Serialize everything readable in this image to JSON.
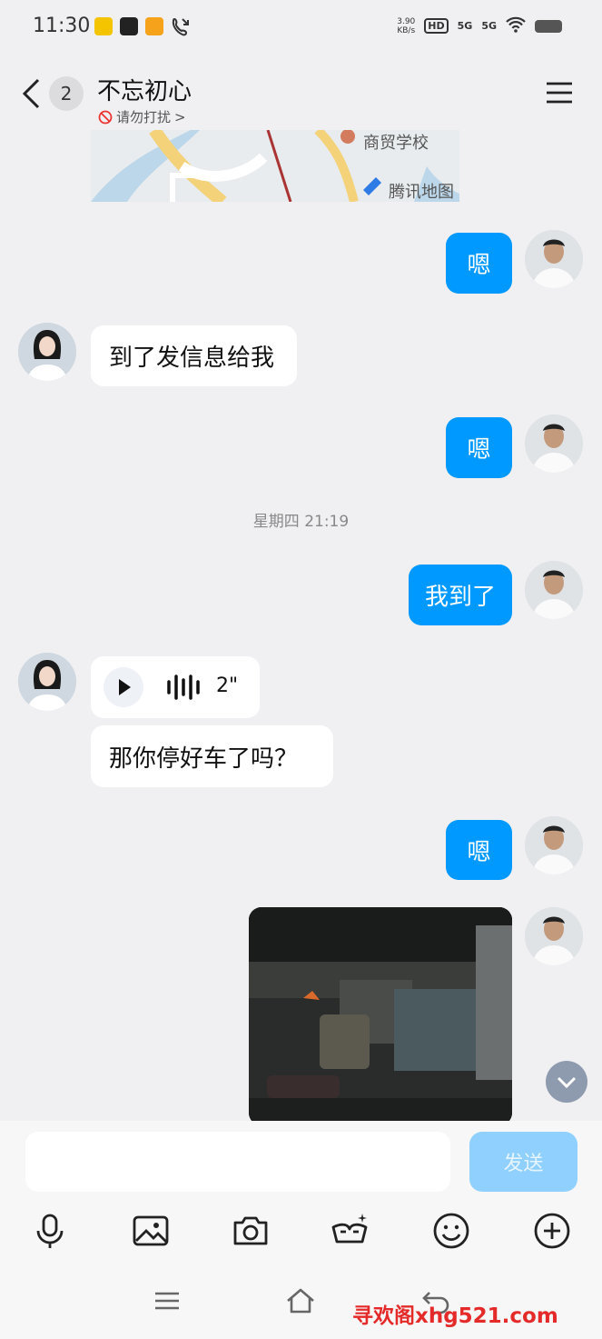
{
  "status_bar": {
    "time": "11:30",
    "net_speed_value": "3.90",
    "net_speed_unit": "KB/s",
    "hd_label": "HD",
    "signal_1": "5G",
    "signal_2": "5G"
  },
  "header": {
    "unread_count": "2",
    "title": "不忘初心",
    "dnd_label": "请勿打扰",
    "dnd_chevron": ">"
  },
  "map": {
    "place_label": "商贸学校",
    "provider_label": "腾讯地图"
  },
  "messages": {
    "me_1": "嗯",
    "other_1": "到了发信息给我",
    "me_2": "嗯",
    "timestamp": "星期四 21:19",
    "me_3": "我到了",
    "voice_duration": "2\"",
    "other_2": "那你停好车了吗？",
    "me_4": "嗯"
  },
  "input": {
    "placeholder": "",
    "send_label": "发送"
  },
  "watermark": "寻欢阁xhg521.com",
  "colors": {
    "accent": "#0099ff",
    "send_disabled": "#8fd0ff",
    "background": "#f0f0f2",
    "watermark": "#e52a2a"
  },
  "icons": [
    "back-chevron-icon",
    "menu-icon",
    "no-entry-icon",
    "play-icon",
    "voice-wave-icon",
    "microphone-icon",
    "image-icon",
    "camera-icon",
    "sticker-icon",
    "emoji-icon",
    "plus-icon",
    "chevron-down-icon"
  ]
}
